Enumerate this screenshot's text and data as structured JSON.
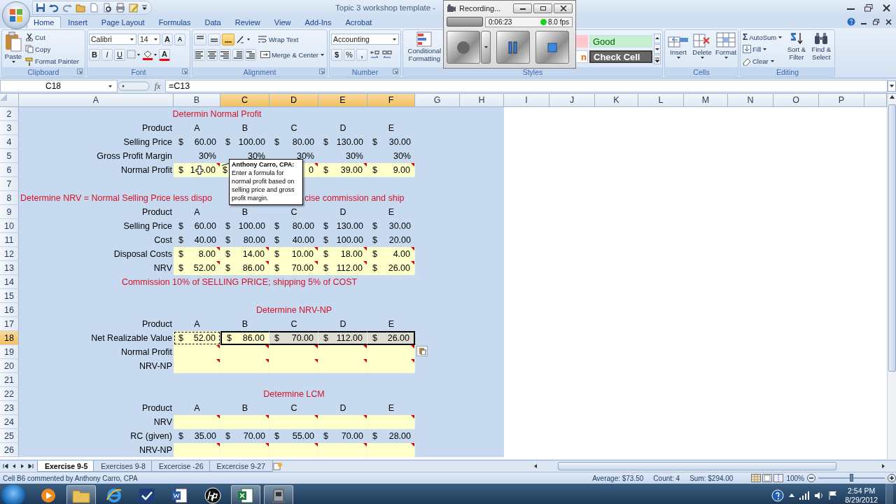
{
  "window": {
    "title": "Topic 3 workshop template -"
  },
  "ribbon_tabs": [
    {
      "label": "Home",
      "selected": true
    },
    {
      "label": "Insert",
      "selected": false
    },
    {
      "label": "Page Layout",
      "selected": false
    },
    {
      "label": "Formulas",
      "selected": false
    },
    {
      "label": "Data",
      "selected": false
    },
    {
      "label": "Review",
      "selected": false
    },
    {
      "label": "View",
      "selected": false
    },
    {
      "label": "Add-Ins",
      "selected": false
    },
    {
      "label": "Acrobat",
      "selected": false
    }
  ],
  "ribbon": {
    "clipboard": {
      "label": "Clipboard",
      "paste": "Paste",
      "cut": "Cut",
      "copy": "Copy",
      "format_painter": "Format Painter"
    },
    "font": {
      "label": "Font",
      "family": "Calibri",
      "size": "14",
      "grow": "A",
      "shrink": "A",
      "bold": "B",
      "italic": "I",
      "underline": "U",
      "font_color": "A"
    },
    "alignment": {
      "label": "Alignment",
      "vertical_align": [
        {
          "selected": false
        },
        {
          "selected": false
        },
        {
          "selected": true
        }
      ],
      "wrap_text": "Wrap Text",
      "merge_center": "Merge & Center"
    },
    "number": {
      "label": "Number",
      "format": "Accounting",
      "currency": "$",
      "percent": "%",
      "comma": ","
    },
    "styles": {
      "label": "Styles",
      "conditional_formatting": "Conditional Formatting",
      "cell_styles": [
        {
          "kind": "bad"
        },
        {
          "kind": "good",
          "label": "Good"
        },
        {
          "kind": "neutral",
          "label": "n"
        },
        {
          "kind": "check",
          "label": "Check Cell"
        }
      ]
    },
    "cells": {
      "label": "Cells",
      "buttons": [
        {
          "kind": "insert",
          "label": "Insert"
        },
        {
          "kind": "delete",
          "label": "Delete"
        },
        {
          "kind": "format",
          "label": "Format"
        }
      ]
    },
    "editing": {
      "label": "Editing",
      "sigma": "Σ",
      "autosum": "AutoSum",
      "fill": "Fill",
      "clear": "Clear",
      "sort_filter": "Sort & Filter",
      "find_select": "Find & Select"
    }
  },
  "recorder": {
    "title": "Recording...",
    "elapsed": "0:06:23",
    "fps": "8.0 fps",
    "active": true
  },
  "formula_bar": {
    "name_box": "C18",
    "function_label": "fx",
    "value": "=C13"
  },
  "columns": [
    {
      "label": "A",
      "selected": false
    },
    {
      "label": "B",
      "selected": false
    },
    {
      "label": "C",
      "selected": true
    },
    {
      "label": "D",
      "selected": true
    },
    {
      "label": "E",
      "selected": true
    },
    {
      "label": "F",
      "selected": true
    },
    {
      "label": "G",
      "selected": false
    },
    {
      "label": "H",
      "selected": false
    },
    {
      "label": "I",
      "selected": false
    },
    {
      "label": "J",
      "selected": false
    },
    {
      "label": "K",
      "selected": false
    },
    {
      "label": "L",
      "selected": false
    },
    {
      "label": "M",
      "selected": false
    },
    {
      "label": "N",
      "selected": false
    },
    {
      "label": "O",
      "selected": false
    },
    {
      "label": "P",
      "selected": false
    }
  ],
  "rows": [
    {
      "num": "2",
      "selected": false,
      "kind": "title",
      "text": "Determin Normal Profit"
    },
    {
      "num": "3",
      "selected": false,
      "kind": "header",
      "label": "Product",
      "values": [
        "A",
        "B",
        "C",
        "D",
        "E"
      ]
    },
    {
      "num": "4",
      "selected": false,
      "kind": "money",
      "label": "Selling Price",
      "values": [
        {
          "symbol": "$",
          "amount": "60.00"
        },
        {
          "symbol": "$",
          "amount": "100.00"
        },
        {
          "symbol": "$",
          "amount": "80.00"
        },
        {
          "symbol": "$",
          "amount": "130.00"
        },
        {
          "symbol": "$",
          "amount": "30.00"
        }
      ]
    },
    {
      "num": "5",
      "selected": false,
      "kind": "percent",
      "label": "Gross Profit Margin",
      "values": [
        "30%",
        "30%",
        "30%",
        "30%",
        "30%"
      ]
    },
    {
      "num": "6",
      "selected": false,
      "kind": "money",
      "label": "Normal Profit",
      "highlighted": true,
      "commented": true,
      "values": [
        {
          "symbol": "$",
          "amount": "1",
          "pointer": true,
          "tail": ".00"
        },
        {
          "symbol": "$"
        },
        {
          "amount": "0"
        },
        {
          "symbol": "$",
          "amount": "39.00"
        },
        {
          "symbol": "$",
          "amount": "9.00"
        }
      ]
    },
    {
      "num": "7",
      "selected": false,
      "kind": "blank"
    },
    {
      "num": "8",
      "selected": false,
      "kind": "split_note",
      "text": "Determine NRV = Normal Selling Price less dispo",
      "text_after": "cise commission and ship"
    },
    {
      "num": "9",
      "selected": false,
      "kind": "header",
      "label": "Product",
      "values": [
        "A",
        "B",
        "C",
        "D",
        "E"
      ]
    },
    {
      "num": "10",
      "selected": false,
      "kind": "money",
      "label": "Selling Price",
      "values": [
        {
          "symbol": "$",
          "amount": "60.00"
        },
        {
          "symbol": "$",
          "amount": "100.00"
        },
        {
          "symbol": "$",
          "amount": "80.00"
        },
        {
          "symbol": "$",
          "amount": "130.00"
        },
        {
          "symbol": "$",
          "amount": "30.00"
        }
      ]
    },
    {
      "num": "11",
      "selected": false,
      "kind": "money",
      "label": "Cost",
      "values": [
        {
          "symbol": "$",
          "amount": "40.00"
        },
        {
          "symbol": "$",
          "amount": "80.00"
        },
        {
          "symbol": "$",
          "amount": "40.00"
        },
        {
          "symbol": "$",
          "amount": "100.00"
        },
        {
          "symbol": "$",
          "amount": "20.00"
        }
      ]
    },
    {
      "num": "12",
      "selected": false,
      "kind": "money",
      "label": "Disposal Costs",
      "highlighted": true,
      "commented": true,
      "values": [
        {
          "symbol": "$",
          "amount": "8.00"
        },
        {
          "symbol": "$",
          "amount": "14.00"
        },
        {
          "symbol": "$",
          "amount": "10.00"
        },
        {
          "symbol": "$",
          "amount": "18.00"
        },
        {
          "symbol": "$",
          "amount": "4.00"
        }
      ]
    },
    {
      "num": "13",
      "selected": false,
      "kind": "money",
      "label": "NRV",
      "highlighted": true,
      "commented": true,
      "values": [
        {
          "symbol": "$",
          "amount": "52.00"
        },
        {
          "symbol": "$",
          "amount": "86.00"
        },
        {
          "symbol": "$",
          "amount": "70.00"
        },
        {
          "symbol": "$",
          "amount": "112.00"
        },
        {
          "symbol": "$",
          "amount": "26.00"
        }
      ]
    },
    {
      "num": "14",
      "selected": false,
      "kind": "note",
      "text": "Commission 10% of SELLING PRICE; shipping 5% of COST"
    },
    {
      "num": "15",
      "selected": false,
      "kind": "blank"
    },
    {
      "num": "16",
      "selected": false,
      "kind": "heading",
      "text": "Determine NRV-NP"
    },
    {
      "num": "17",
      "selected": false,
      "kind": "header",
      "label": "Product",
      "values": [
        "A",
        "B",
        "C",
        "D",
        "E"
      ]
    },
    {
      "num": "18",
      "selected": true,
      "kind": "money",
      "label": "Net Realizable Value",
      "highlighted": true,
      "values": [
        {
          "symbol": "$",
          "amount": "52.00",
          "selected": false,
          "active": false,
          "copied": true
        },
        {
          "symbol": "$",
          "amount": "86.00",
          "selected": true,
          "active": true,
          "copied": false
        },
        {
          "symbol": "$",
          "amount": "70.00",
          "selected": true,
          "active": false,
          "copied": false
        },
        {
          "symbol": "$",
          "amount": "112.00",
          "selected": true,
          "active": false,
          "copied": false
        },
        {
          "symbol": "$",
          "amount": "26.00",
          "selected": true,
          "active": false,
          "copied": false
        }
      ]
    },
    {
      "num": "19",
      "selected": false,
      "kind": "input",
      "label": "Normal Profit",
      "highlighted": true,
      "commented": true
    },
    {
      "num": "20",
      "selected": false,
      "kind": "input",
      "label": "NRV-NP",
      "highlighted": true,
      "commented": true
    },
    {
      "num": "21",
      "selected": false,
      "kind": "blank"
    },
    {
      "num": "22",
      "selected": false,
      "kind": "heading",
      "text": "Determine LCM"
    },
    {
      "num": "23",
      "selected": false,
      "kind": "header",
      "label": "Product",
      "values": [
        "A",
        "B",
        "C",
        "D",
        "E"
      ]
    },
    {
      "num": "24",
      "selected": false,
      "kind": "input",
      "label": "NRV",
      "highlighted": true,
      "commented": true
    },
    {
      "num": "25",
      "selected": false,
      "kind": "money",
      "label": "RC (given)",
      "values": [
        {
          "symbol": "$",
          "amount": "35.00"
        },
        {
          "symbol": "$",
          "amount": "70.00"
        },
        {
          "symbol": "$",
          "amount": "55.00"
        },
        {
          "symbol": "$",
          "amount": "70.00"
        },
        {
          "symbol": "$",
          "amount": "28.00"
        }
      ]
    },
    {
      "num": "26",
      "selected": false,
      "kind": "input",
      "label": "NRV-NP",
      "highlighted": true,
      "commented": true
    }
  ],
  "comment": {
    "author": "Anthony Carro, CPA:",
    "text": "Enter a formula for normal profit based on selling price and gross profit margin."
  },
  "sheet_tabs": [
    {
      "label": "Exercise 9-5",
      "selected": true
    },
    {
      "label": "Exercises 9-8",
      "selected": false
    },
    {
      "label": "Excercise -26",
      "selected": false
    },
    {
      "label": "Excercise 9-27",
      "selected": false
    }
  ],
  "status_bar": {
    "message": "Cell B6 commented by Anthony Carro, CPA",
    "average": "Average: $73.50",
    "count": "Count: 4",
    "sum": "Sum: $294.00",
    "zoom": "100%",
    "level": 0.5
  },
  "taskbar": {
    "apps": [
      {
        "kind": "media",
        "running": false
      },
      {
        "kind": "folder",
        "running": true
      },
      {
        "kind": "browser",
        "running": false
      },
      {
        "kind": "check",
        "running": false
      },
      {
        "kind": "word",
        "running": false
      },
      {
        "kind": "hp",
        "running": false
      },
      {
        "kind": "excel",
        "running": true
      },
      {
        "kind": "recorder",
        "running": true
      }
    ],
    "time": "2:54 PM",
    "date": "8/29/2012"
  }
}
